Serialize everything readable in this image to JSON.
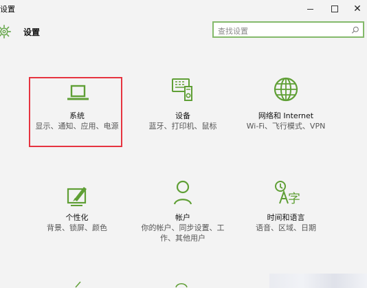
{
  "window": {
    "title": "设置",
    "minimize": "minimize",
    "maximize": "maximize",
    "close": "close"
  },
  "header": {
    "title": "设置",
    "search_placeholder": "查找设置"
  },
  "tiles": [
    {
      "title": "系统",
      "description": "显示、通知、应用、电源",
      "icon": "laptop-icon",
      "selected": true
    },
    {
      "title": "设备",
      "description": "蓝牙、打印机、鼠标",
      "icon": "devices-icon"
    },
    {
      "title": "网络和 Internet",
      "description": "Wi-Fi、飞行模式、VPN",
      "icon": "globe-icon"
    },
    {
      "title": "个性化",
      "description": "背景、锁屏、颜色",
      "icon": "personalize-icon"
    },
    {
      "title": "帐户",
      "description": "你的帐户、同步设置、工作、其他用户",
      "icon": "user-icon"
    },
    {
      "title": "时间和语言",
      "description": "语音、区域、日期",
      "icon": "time-language-icon"
    }
  ],
  "colors": {
    "accent": "#6aa84f",
    "icon": "#5f9f35",
    "selected_border": "#e6333f",
    "search_border": "#83b96a"
  }
}
